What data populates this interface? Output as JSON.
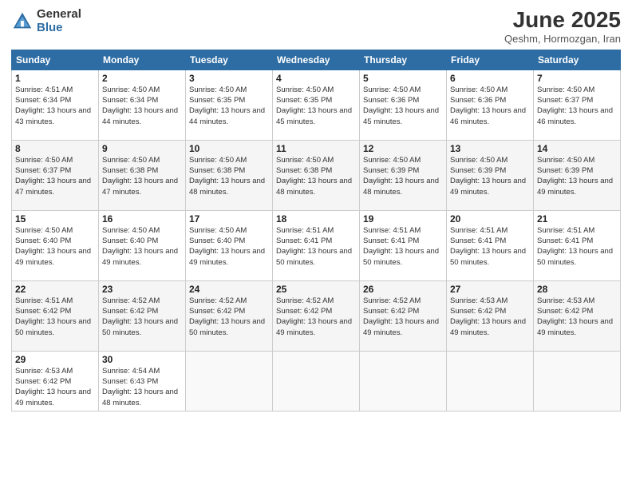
{
  "logo": {
    "general": "General",
    "blue": "Blue"
  },
  "title": "June 2025",
  "subtitle": "Qeshm, Hormozgan, Iran",
  "headers": [
    "Sunday",
    "Monday",
    "Tuesday",
    "Wednesday",
    "Thursday",
    "Friday",
    "Saturday"
  ],
  "weeks": [
    [
      {
        "day": "1",
        "sunrise": "4:51 AM",
        "sunset": "6:34 PM",
        "daylight": "13 hours and 43 minutes."
      },
      {
        "day": "2",
        "sunrise": "4:50 AM",
        "sunset": "6:34 PM",
        "daylight": "13 hours and 44 minutes."
      },
      {
        "day": "3",
        "sunrise": "4:50 AM",
        "sunset": "6:35 PM",
        "daylight": "13 hours and 44 minutes."
      },
      {
        "day": "4",
        "sunrise": "4:50 AM",
        "sunset": "6:35 PM",
        "daylight": "13 hours and 45 minutes."
      },
      {
        "day": "5",
        "sunrise": "4:50 AM",
        "sunset": "6:36 PM",
        "daylight": "13 hours and 45 minutes."
      },
      {
        "day": "6",
        "sunrise": "4:50 AM",
        "sunset": "6:36 PM",
        "daylight": "13 hours and 46 minutes."
      },
      {
        "day": "7",
        "sunrise": "4:50 AM",
        "sunset": "6:37 PM",
        "daylight": "13 hours and 46 minutes."
      }
    ],
    [
      {
        "day": "8",
        "sunrise": "4:50 AM",
        "sunset": "6:37 PM",
        "daylight": "13 hours and 47 minutes."
      },
      {
        "day": "9",
        "sunrise": "4:50 AM",
        "sunset": "6:38 PM",
        "daylight": "13 hours and 47 minutes."
      },
      {
        "day": "10",
        "sunrise": "4:50 AM",
        "sunset": "6:38 PM",
        "daylight": "13 hours and 48 minutes."
      },
      {
        "day": "11",
        "sunrise": "4:50 AM",
        "sunset": "6:38 PM",
        "daylight": "13 hours and 48 minutes."
      },
      {
        "day": "12",
        "sunrise": "4:50 AM",
        "sunset": "6:39 PM",
        "daylight": "13 hours and 48 minutes."
      },
      {
        "day": "13",
        "sunrise": "4:50 AM",
        "sunset": "6:39 PM",
        "daylight": "13 hours and 49 minutes."
      },
      {
        "day": "14",
        "sunrise": "4:50 AM",
        "sunset": "6:39 PM",
        "daylight": "13 hours and 49 minutes."
      }
    ],
    [
      {
        "day": "15",
        "sunrise": "4:50 AM",
        "sunset": "6:40 PM",
        "daylight": "13 hours and 49 minutes."
      },
      {
        "day": "16",
        "sunrise": "4:50 AM",
        "sunset": "6:40 PM",
        "daylight": "13 hours and 49 minutes."
      },
      {
        "day": "17",
        "sunrise": "4:50 AM",
        "sunset": "6:40 PM",
        "daylight": "13 hours and 49 minutes."
      },
      {
        "day": "18",
        "sunrise": "4:51 AM",
        "sunset": "6:41 PM",
        "daylight": "13 hours and 50 minutes."
      },
      {
        "day": "19",
        "sunrise": "4:51 AM",
        "sunset": "6:41 PM",
        "daylight": "13 hours and 50 minutes."
      },
      {
        "day": "20",
        "sunrise": "4:51 AM",
        "sunset": "6:41 PM",
        "daylight": "13 hours and 50 minutes."
      },
      {
        "day": "21",
        "sunrise": "4:51 AM",
        "sunset": "6:41 PM",
        "daylight": "13 hours and 50 minutes."
      }
    ],
    [
      {
        "day": "22",
        "sunrise": "4:51 AM",
        "sunset": "6:42 PM",
        "daylight": "13 hours and 50 minutes."
      },
      {
        "day": "23",
        "sunrise": "4:52 AM",
        "sunset": "6:42 PM",
        "daylight": "13 hours and 50 minutes."
      },
      {
        "day": "24",
        "sunrise": "4:52 AM",
        "sunset": "6:42 PM",
        "daylight": "13 hours and 50 minutes."
      },
      {
        "day": "25",
        "sunrise": "4:52 AM",
        "sunset": "6:42 PM",
        "daylight": "13 hours and 49 minutes."
      },
      {
        "day": "26",
        "sunrise": "4:52 AM",
        "sunset": "6:42 PM",
        "daylight": "13 hours and 49 minutes."
      },
      {
        "day": "27",
        "sunrise": "4:53 AM",
        "sunset": "6:42 PM",
        "daylight": "13 hours and 49 minutes."
      },
      {
        "day": "28",
        "sunrise": "4:53 AM",
        "sunset": "6:42 PM",
        "daylight": "13 hours and 49 minutes."
      }
    ],
    [
      {
        "day": "29",
        "sunrise": "4:53 AM",
        "sunset": "6:42 PM",
        "daylight": "13 hours and 49 minutes."
      },
      {
        "day": "30",
        "sunrise": "4:54 AM",
        "sunset": "6:43 PM",
        "daylight": "13 hours and 48 minutes."
      },
      null,
      null,
      null,
      null,
      null
    ]
  ]
}
